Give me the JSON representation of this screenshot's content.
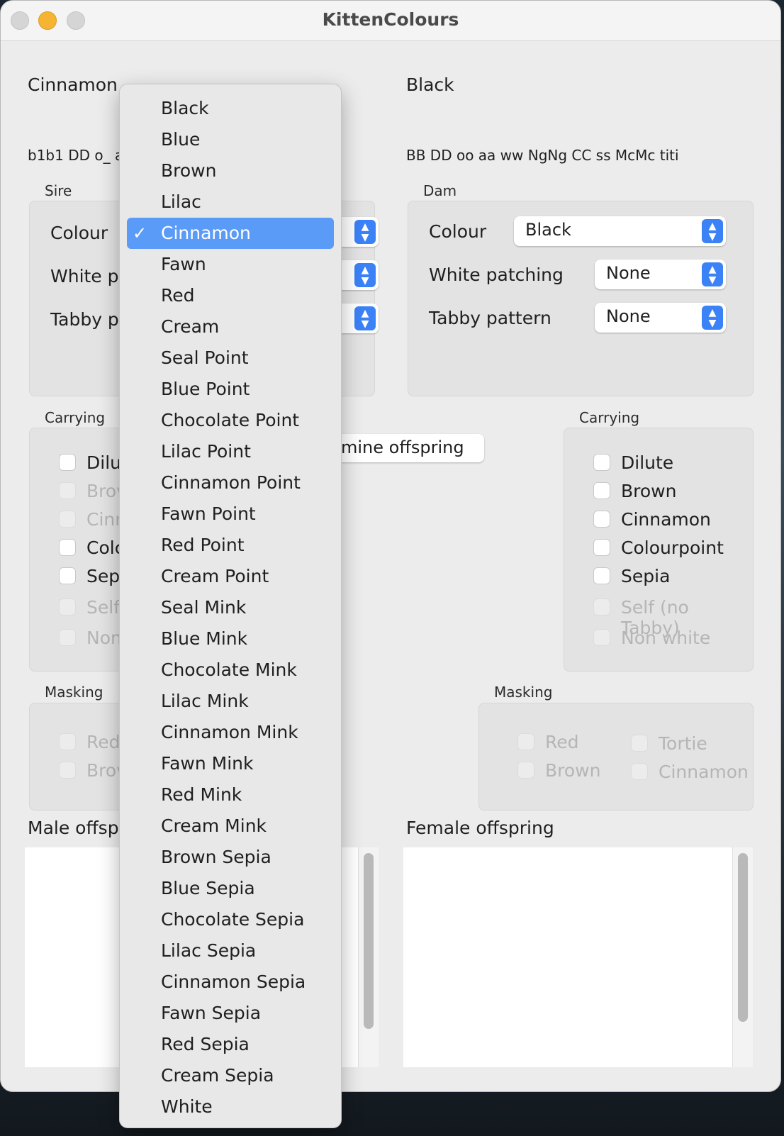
{
  "window": {
    "title": "KittenColours"
  },
  "sire": {
    "heading": "Cinnamon",
    "genotype": "b1b1 DD o_ a",
    "group_label": "Sire",
    "colour_label": "Colour",
    "white_label": "White pa",
    "tabby_label": "Tabby pa",
    "carrying_label": "Carrying",
    "carrying": [
      {
        "label": "Dilut",
        "enabled": true
      },
      {
        "label": "Brov",
        "enabled": false
      },
      {
        "label": "Cinn",
        "enabled": false
      },
      {
        "label": "Colc",
        "enabled": true
      },
      {
        "label": "Sep",
        "enabled": true
      },
      {
        "label": "Self",
        "enabled": false
      },
      {
        "label": "Non",
        "enabled": false
      }
    ],
    "masking_label": "Masking",
    "masking": [
      {
        "label": "Red",
        "enabled": false
      },
      {
        "label": "Brov",
        "enabled": false
      }
    ],
    "offspring_label": "Male offspr"
  },
  "dam": {
    "heading": "Black",
    "genotype": "BB DD oo aa ww NgNg CC ss McMc titi",
    "group_label": "Dam",
    "colour_label": "Colour",
    "colour_value": "Black",
    "white_label": "White patching",
    "white_value": "None",
    "tabby_label": "Tabby pattern",
    "tabby_value": "None",
    "carrying_label": "Carrying",
    "carrying": [
      {
        "label": "Dilute",
        "enabled": true
      },
      {
        "label": "Brown",
        "enabled": true
      },
      {
        "label": "Cinnamon",
        "enabled": true
      },
      {
        "label": "Colourpoint",
        "enabled": true
      },
      {
        "label": "Sepia",
        "enabled": true
      },
      {
        "label": "Self (no Tabby)",
        "enabled": false
      },
      {
        "label": "Non white",
        "enabled": false
      }
    ],
    "masking_label": "Masking",
    "masking_left": [
      {
        "label": "Red",
        "enabled": false
      },
      {
        "label": "Brown",
        "enabled": false
      }
    ],
    "masking_right": [
      {
        "label": "Tortie",
        "enabled": false
      },
      {
        "label": "Cinnamon",
        "enabled": false
      }
    ],
    "offspring_label": "Female offspring"
  },
  "determine_button": "mine offspring",
  "colour_menu": {
    "selected": "Cinnamon",
    "check_glyph": "✓",
    "items": [
      "Black",
      "Blue",
      "Brown",
      "Lilac",
      "Cinnamon",
      "Fawn",
      "Red",
      "Cream",
      "Seal Point",
      "Blue Point",
      "Chocolate Point",
      "Lilac Point",
      "Cinnamon Point",
      "Fawn Point",
      "Red Point",
      "Cream Point",
      "Seal Mink",
      "Blue Mink",
      "Chocolate Mink",
      "Lilac Mink",
      "Cinnamon Mink",
      "Fawn Mink",
      "Red Mink",
      "Cream Mink",
      "Brown Sepia",
      "Blue Sepia",
      "Chocolate Sepia",
      "Lilac Sepia",
      "Cinnamon Sepia",
      "Fawn Sepia",
      "Red Sepia",
      "Cream Sepia",
      "White"
    ]
  },
  "icons": {
    "stepper": "up-down-chevron-icon"
  },
  "colors": {
    "accent": "#3b82f6",
    "selection": "#5b9bf8"
  }
}
